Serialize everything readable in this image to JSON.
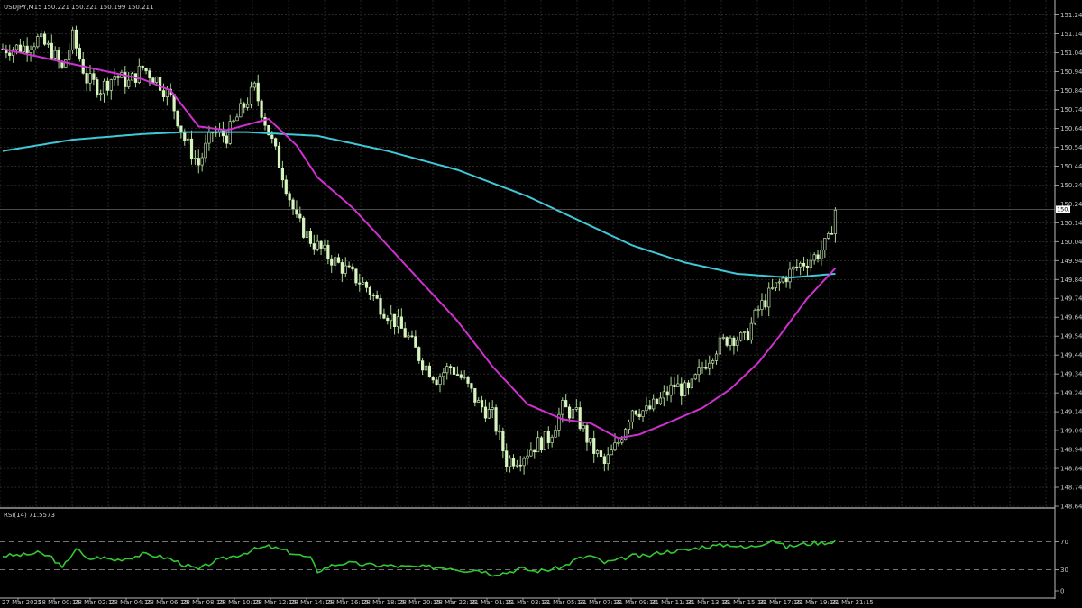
{
  "header": {
    "symbol_timeframe": "USDJPY,M15",
    "ohlc": "150.221 150.221 150.199 150.211"
  },
  "current_price_label": "150.211",
  "colors": {
    "background": "#000000",
    "grid": "#3c3c3c",
    "candle_body": "#d8f5c0",
    "candle_wick": "#a8d890",
    "ma_fast": "#d030d0",
    "ma_slow": "#40c8d8",
    "rsi_line": "#32c832",
    "axis_text": "#c8c8c8",
    "separator": "#bbbbbb"
  },
  "chart_data": [
    {
      "type": "candlestick",
      "title": "USDJPY,M15",
      "ylim": [
        148.64,
        151.3
      ],
      "grid": true,
      "price_ticks": [
        "151.240",
        "151.140",
        "151.040",
        "150.940",
        "150.840",
        "150.740",
        "150.640",
        "150.540",
        "150.440",
        "150.340",
        "150.240",
        "150.140",
        "150.040",
        "149.940",
        "149.840",
        "149.740",
        "149.640",
        "149.540",
        "149.440",
        "149.340",
        "149.240",
        "149.140",
        "149.040",
        "148.940",
        "148.840",
        "148.740",
        "148.640"
      ],
      "x_ticks": [
        "27 Mar 2025",
        "28 Mar 00:15",
        "28 Mar 02:15",
        "28 Mar 04:15",
        "28 Mar 06:15",
        "28 Mar 08:15",
        "28 Mar 10:15",
        "28 Mar 12:15",
        "28 Mar 14:15",
        "28 Mar 16:15",
        "28 Mar 18:15",
        "28 Mar 20:15",
        "28 Mar 22:15",
        "31 Mar 01:15",
        "31 Mar 03:15",
        "31 Mar 05:15",
        "31 Mar 07:15",
        "31 Mar 09:15",
        "31 Mar 11:15",
        "31 Mar 13:15",
        "31 Mar 15:15",
        "31 Mar 17:15",
        "31 Mar 19:15",
        "31 Mar 21:15"
      ],
      "close_anchors": [
        [
          0,
          151.06
        ],
        [
          6,
          151.07
        ],
        [
          10,
          151.11
        ],
        [
          14,
          151.05
        ],
        [
          17,
          150.95
        ],
        [
          20,
          151.12
        ],
        [
          24,
          150.9
        ],
        [
          28,
          150.85
        ],
        [
          32,
          150.92
        ],
        [
          36,
          150.88
        ],
        [
          40,
          150.96
        ],
        [
          44,
          150.9
        ],
        [
          48,
          150.8
        ],
        [
          52,
          150.58
        ],
        [
          56,
          150.45
        ],
        [
          60,
          150.62
        ],
        [
          64,
          150.6
        ],
        [
          68,
          150.73
        ],
        [
          72,
          150.85
        ],
        [
          76,
          150.62
        ],
        [
          80,
          150.4
        ],
        [
          84,
          150.15
        ],
        [
          88,
          150.05
        ],
        [
          92,
          149.98
        ],
        [
          96,
          149.92
        ],
        [
          100,
          149.86
        ],
        [
          104,
          149.8
        ],
        [
          108,
          149.7
        ],
        [
          112,
          149.62
        ],
        [
          116,
          149.53
        ],
        [
          120,
          149.4
        ],
        [
          124,
          149.32
        ],
        [
          128,
          149.38
        ],
        [
          132,
          149.3
        ],
        [
          136,
          149.18
        ],
        [
          140,
          149.12
        ],
        [
          144,
          148.88
        ],
        [
          148,
          148.9
        ],
        [
          152,
          148.96
        ],
        [
          156,
          149.0
        ],
        [
          160,
          149.16
        ],
        [
          164,
          149.12
        ],
        [
          168,
          148.96
        ],
        [
          172,
          148.86
        ],
        [
          176,
          148.98
        ],
        [
          180,
          149.16
        ],
        [
          184,
          149.14
        ],
        [
          188,
          149.2
        ],
        [
          192,
          149.28
        ],
        [
          196,
          149.24
        ],
        [
          200,
          149.38
        ],
        [
          204,
          149.48
        ],
        [
          208,
          149.54
        ],
        [
          212,
          149.52
        ],
        [
          216,
          149.68
        ],
        [
          220,
          149.78
        ],
        [
          224,
          149.86
        ],
        [
          228,
          149.92
        ],
        [
          232,
          149.96
        ],
        [
          236,
          150.04
        ],
        [
          238,
          150.21
        ]
      ],
      "candle_count": 239,
      "overlays": [
        {
          "name": "",
          "kind": "moving-average-fast",
          "values_at": [
            [
              0,
              151.06
            ],
            [
              20,
              150.98
            ],
            [
              40,
              150.9
            ],
            [
              48,
              150.84
            ],
            [
              56,
              150.65
            ],
            [
              64,
              150.63
            ],
            [
              76,
              150.69
            ],
            [
              84,
              150.55
            ],
            [
              90,
              150.38
            ],
            [
              100,
              150.22
            ],
            [
              110,
              150.02
            ],
            [
              120,
              149.82
            ],
            [
              130,
              149.62
            ],
            [
              140,
              149.38
            ],
            [
              150,
              149.18
            ],
            [
              160,
              149.1
            ],
            [
              168,
              149.08
            ],
            [
              176,
              149.0
            ],
            [
              182,
              149.02
            ],
            [
              190,
              149.08
            ],
            [
              200,
              149.16
            ],
            [
              208,
              149.26
            ],
            [
              216,
              149.4
            ],
            [
              222,
              149.54
            ],
            [
              230,
              149.74
            ],
            [
              238,
              149.9
            ]
          ]
        },
        {
          "name": "",
          "kind": "moving-average-slow",
          "values_at": [
            [
              0,
              150.52
            ],
            [
              20,
              150.58
            ],
            [
              40,
              150.61
            ],
            [
              52,
              150.62
            ],
            [
              70,
              150.62
            ],
            [
              90,
              150.6
            ],
            [
              110,
              150.52
            ],
            [
              130,
              150.42
            ],
            [
              150,
              150.28
            ],
            [
              165,
              150.15
            ],
            [
              180,
              150.02
            ],
            [
              195,
              149.93
            ],
            [
              210,
              149.87
            ],
            [
              225,
              149.85
            ],
            [
              238,
              149.87
            ]
          ]
        }
      ]
    },
    {
      "type": "line",
      "title": "RSI(14) 71.5573",
      "ylim": [
        0,
        100
      ],
      "levels": [
        "70",
        "30",
        "0"
      ],
      "series": [
        {
          "name": "",
          "values_at": [
            [
              0,
              50
            ],
            [
              6,
              51
            ],
            [
              10,
              54
            ],
            [
              14,
              48
            ],
            [
              17,
              32
            ],
            [
              21,
              61
            ],
            [
              24,
              45
            ],
            [
              28,
              48
            ],
            [
              32,
              44
            ],
            [
              36,
              47
            ],
            [
              40,
              52
            ],
            [
              44,
              50
            ],
            [
              48,
              45
            ],
            [
              52,
              37
            ],
            [
              56,
              30
            ],
            [
              60,
              41
            ],
            [
              64,
              47
            ],
            [
              68,
              52
            ],
            [
              72,
              59
            ],
            [
              76,
              63
            ],
            [
              80,
              58
            ],
            [
              84,
              52
            ],
            [
              88,
              46
            ],
            [
              90,
              28
            ],
            [
              94,
              36
            ],
            [
              98,
              40
            ],
            [
              104,
              37
            ],
            [
              110,
              36
            ],
            [
              116,
              34
            ],
            [
              122,
              34
            ],
            [
              128,
              33
            ],
            [
              132,
              29
            ],
            [
              136,
              30
            ],
            [
              140,
              24
            ],
            [
              144,
              26
            ],
            [
              148,
              32
            ],
            [
              152,
              28
            ],
            [
              156,
              30
            ],
            [
              160,
              34
            ],
            [
              164,
              45
            ],
            [
              168,
              50
            ],
            [
              172,
              40
            ],
            [
              176,
              44
            ],
            [
              180,
              50
            ],
            [
              184,
              49
            ],
            [
              188,
              55
            ],
            [
              192,
              57
            ],
            [
              196,
              58
            ],
            [
              200,
              63
            ],
            [
              204,
              64
            ],
            [
              208,
              66
            ],
            [
              212,
              61
            ],
            [
              216,
              65
            ],
            [
              220,
              73
            ],
            [
              224,
              62
            ],
            [
              228,
              66
            ],
            [
              232,
              68
            ],
            [
              236,
              69
            ],
            [
              238,
              71.56
            ]
          ]
        }
      ]
    }
  ]
}
